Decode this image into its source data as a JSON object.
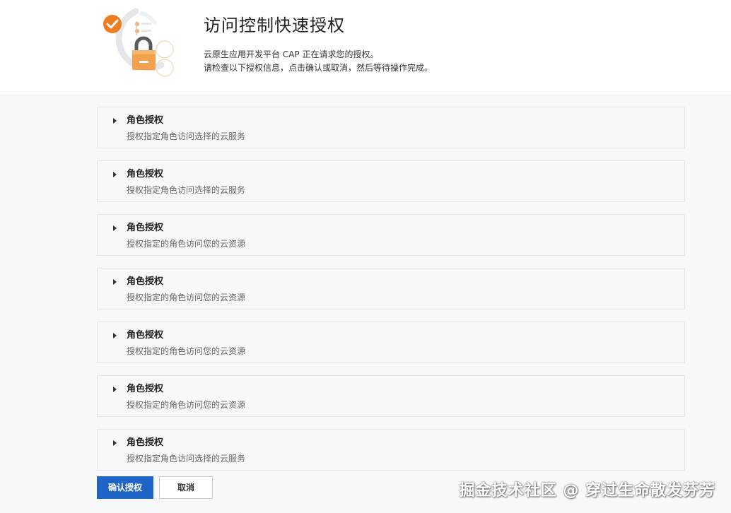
{
  "header": {
    "title": "访问控制快速授权",
    "desc_line1": "云原生应用开发平台 CAP 正在请求您的授权。",
    "desc_line2": "请检查以下授权信息，点击确认或取消，然后等待操作完成。",
    "illustration_icon": "authorization-lock-illustration",
    "accent_color": "#f08a2c"
  },
  "cards": [
    {
      "title": "角色授权",
      "subtitle": "授权指定角色访问选择的云服务"
    },
    {
      "title": "角色授权",
      "subtitle": "授权指定角色访问选择的云服务"
    },
    {
      "title": "角色授权",
      "subtitle": "授权指定的角色访问您的云资源"
    },
    {
      "title": "角色授权",
      "subtitle": "授权指定的角色访问您的云资源"
    },
    {
      "title": "角色授权",
      "subtitle": "授权指定的角色访问您的云资源"
    },
    {
      "title": "角色授权",
      "subtitle": "授权指定的角色访问您的云资源"
    },
    {
      "title": "角色授权",
      "subtitle": "授权指定角色访问选择的云服务"
    }
  ],
  "actions": {
    "confirm_label": "确认授权",
    "cancel_label": "取消",
    "primary_color": "#1f64c7"
  },
  "watermark": "掘金技术社区 @ 穿过生命散发芬芳"
}
